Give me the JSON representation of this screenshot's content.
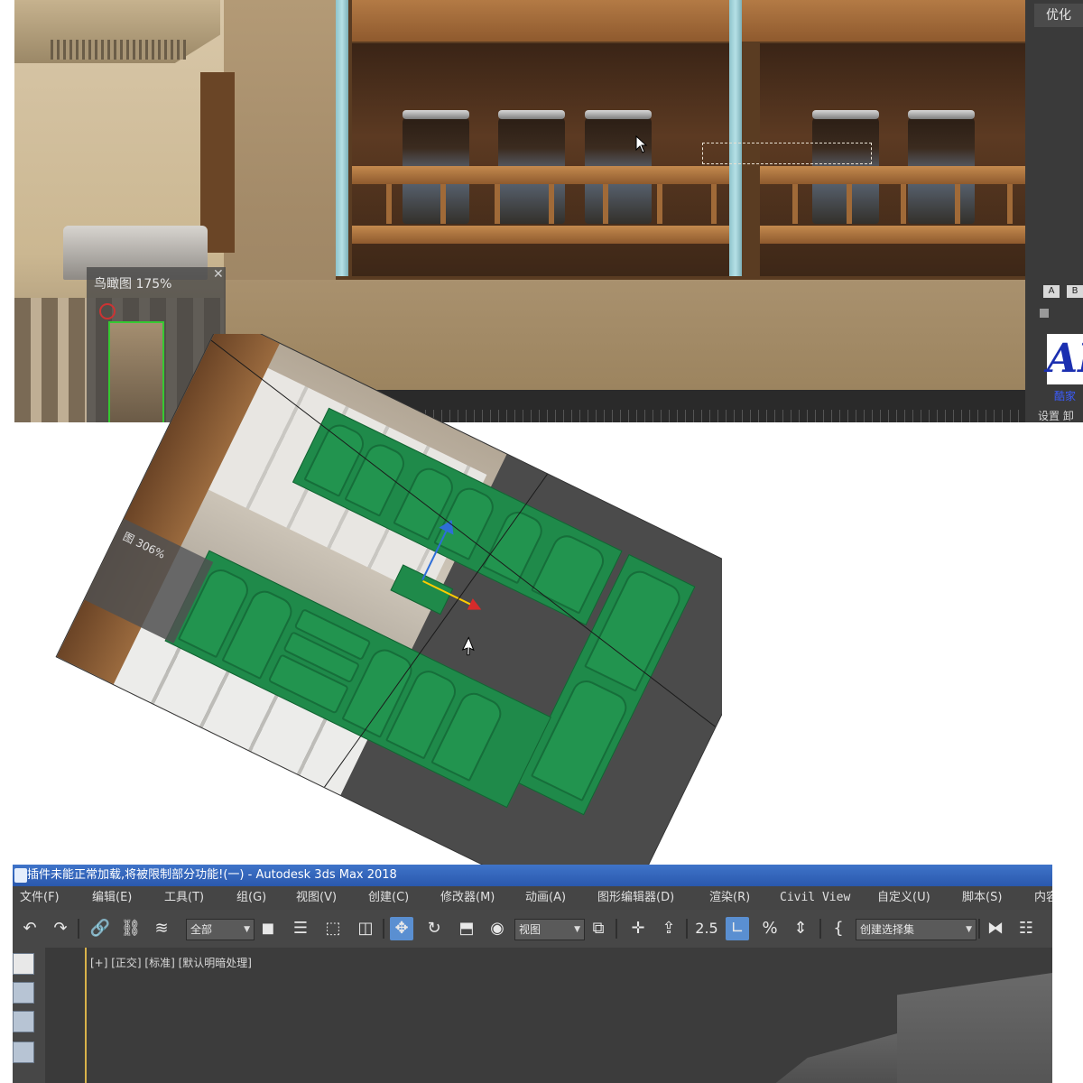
{
  "top_panel": {
    "birdseye_title": "鸟瞰图 175%",
    "optimize_button": "优化",
    "btn_a": "A",
    "btn_b": "B",
    "logo_text": "AI",
    "logo_link_text": "酷家",
    "settings_text": "设置 卸载"
  },
  "mid_panel": {
    "birdseye_title": "图 306%"
  },
  "max_window": {
    "title": "插件未能正常加载,将被限制部分功能!(一) - Autodesk 3ds Max 2018",
    "menu": [
      "文件(F)",
      "编辑(E)",
      "工具(T)",
      "组(G)",
      "视图(V)",
      "创建(C)",
      "修改器(M)",
      "动画(A)",
      "图形编辑器(D)",
      "渲染(R)",
      "Civil View",
      "自定义(U)",
      "脚本(S)",
      "内容"
    ],
    "toolbar": {
      "selection_filter": "全部",
      "reference_coord": "视图",
      "named_selection": "创建选择集",
      "snap_label": "2.5"
    },
    "viewport_label": "[+] [正交] [标准] [默认明暗处理]"
  },
  "colors": {
    "title_bar": "#2a58ad",
    "cabinet_green": "#1f8a4a",
    "active_tool": "#5a8fd1"
  }
}
